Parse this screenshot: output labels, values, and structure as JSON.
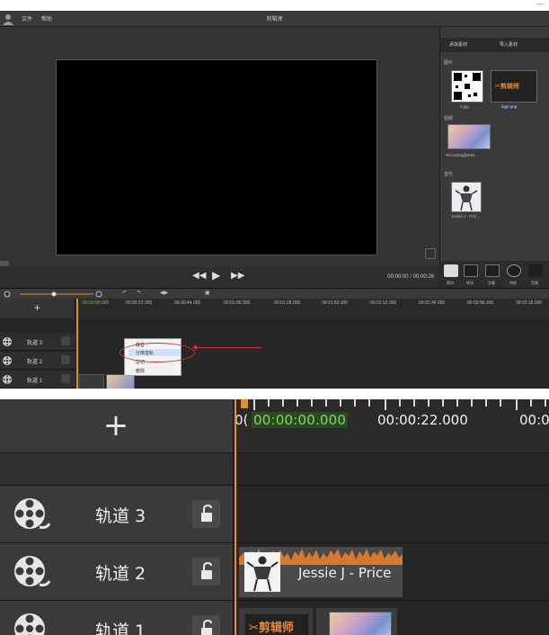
{
  "app": {
    "window_title": "剪辑师",
    "menu": [
      "文件",
      "帮助"
    ],
    "minimize_glyph": "—"
  },
  "right_panel": {
    "tabs": [
      "添加素材",
      "导入素材"
    ],
    "sections": {
      "images_label": "图片",
      "video_label": "视频",
      "audio_label": "音乐"
    },
    "images": [
      {
        "name": "0.jpg"
      },
      {
        "name": "logo.png",
        "logo_text": "✂剪辑师"
      }
    ],
    "videos": [
      {
        "name": "Recording(MHN..."
      }
    ],
    "audio": [
      {
        "name": "Jessie J - Pric..."
      }
    ],
    "tools": [
      "素材",
      "转场",
      "字幕",
      "特效",
      "音频"
    ]
  },
  "player": {
    "timecode": "00:00:00 / 00:00:26"
  },
  "small_timeline": {
    "ruler": [
      "00:00:00.000",
      "00:00:22.000",
      "00:00:44.000",
      "00:01:06.000",
      "00:01:28.000",
      "00:01:50.000",
      "00:02:12.000",
      "00:02:34.000",
      "00:02:56.000",
      "00:03:18.000"
    ],
    "add_label": "+",
    "tracks": [
      "轨道 3",
      "轨道 2",
      "轨道 1"
    ]
  },
  "context_menu": {
    "items": [
      "静音",
      "分离音轨",
      "剪切",
      "删除"
    ],
    "highlighted_index": 1
  },
  "zoom_timeline": {
    "add_label": "+",
    "current_time": "00:00:00.000",
    "tick_time": "00:00:22.000",
    "next_time_fragment": "00:0",
    "left_fragment": "0(",
    "tracks": [
      {
        "name": "轨道 3"
      },
      {
        "name": "轨道 2"
      },
      {
        "name": "轨道 1"
      }
    ],
    "audio_clip_label": "Jessie J - Price",
    "logo_clip_text": "✂剪辑师"
  },
  "colors": {
    "accent_orange": "#e88a2a",
    "timecode_green": "#7ed957",
    "annotation_red": "#d23030"
  }
}
